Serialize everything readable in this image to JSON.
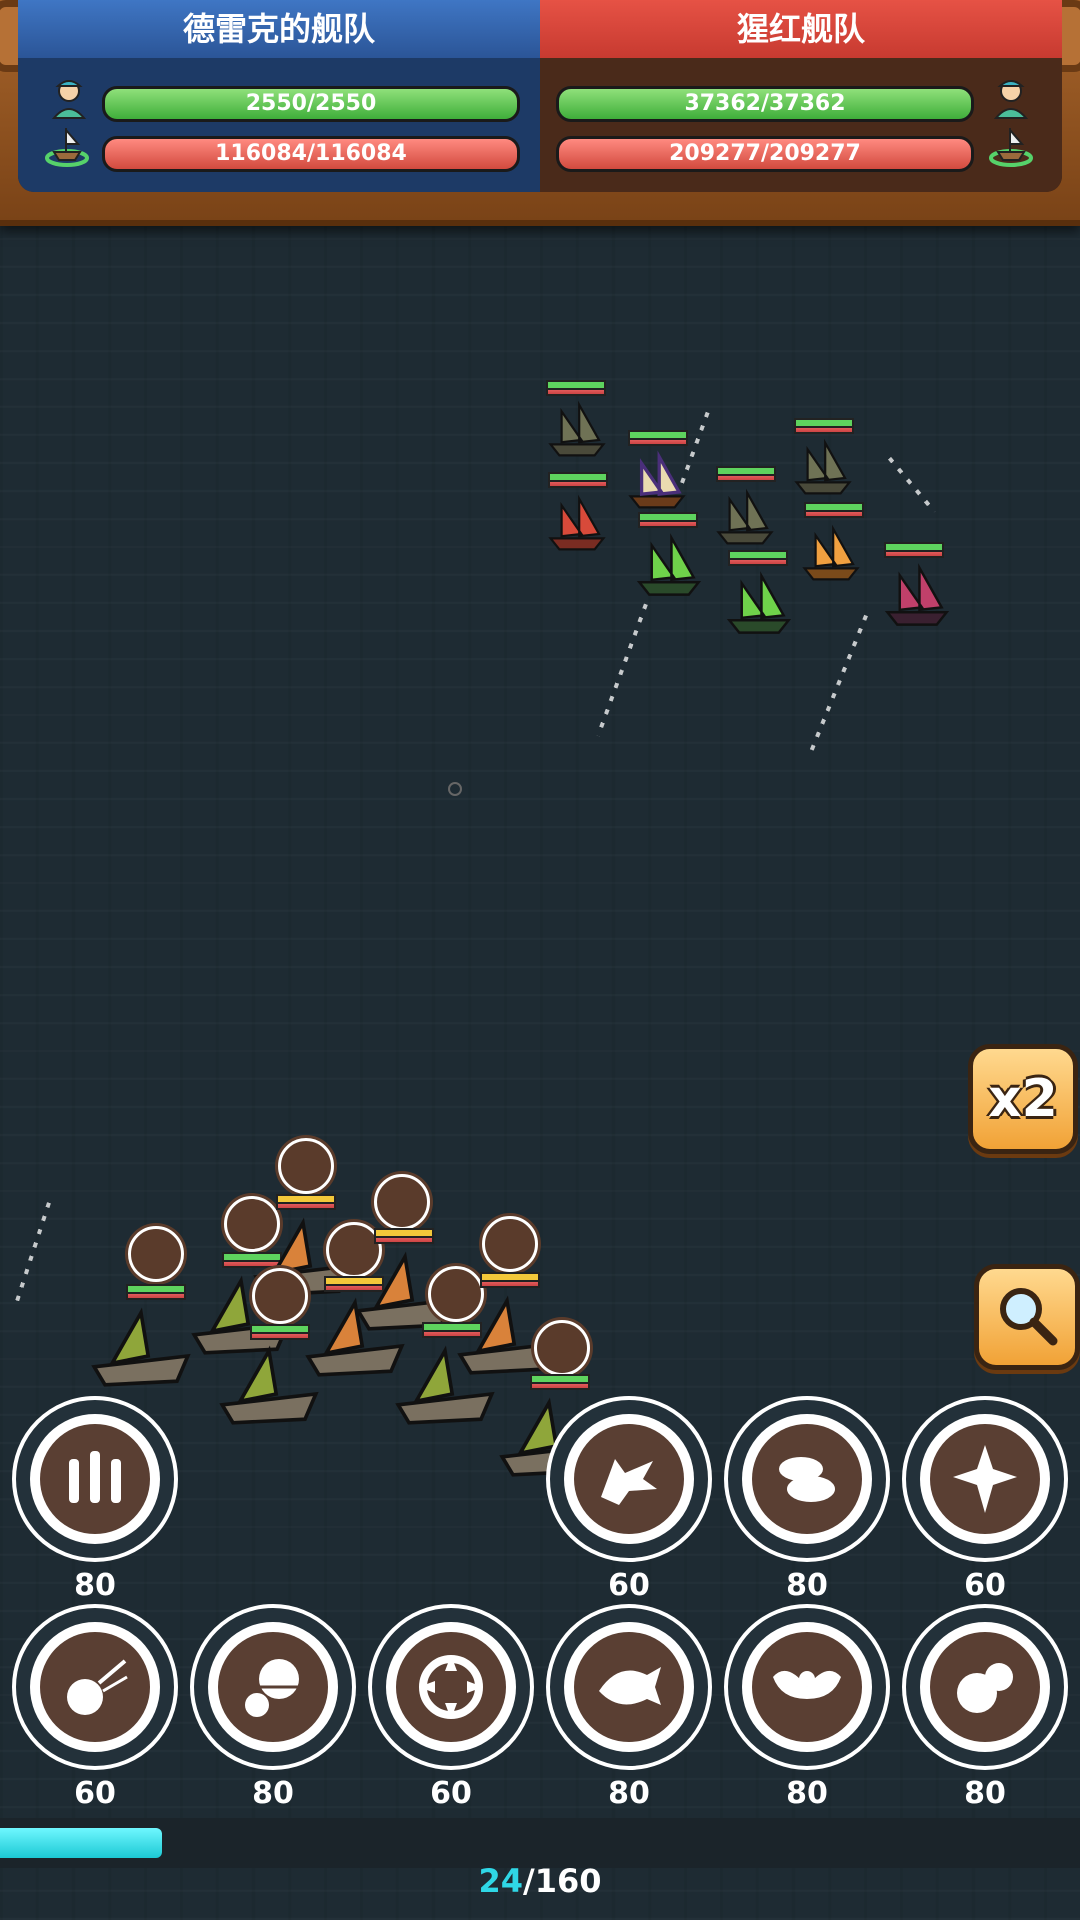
{
  "hud": {
    "left_team": {
      "name": "德雷克的舰队",
      "crew_hp": "2550/2550",
      "ship_hp": "116084/116084"
    },
    "right_team": {
      "name": "猩红舰队",
      "crew_hp": "37362/37362",
      "ship_hp": "209277/209277"
    }
  },
  "controls": {
    "speed_label": "x2",
    "magnify_icon": "magnifier-icon"
  },
  "skills": [
    {
      "icon": "cannons-icon",
      "cost": "80"
    },
    {
      "icon": "wolf-icon",
      "cost": "60"
    },
    {
      "icon": "rolls-icon",
      "cost": "80"
    },
    {
      "icon": "burst-icon",
      "cost": "60"
    },
    {
      "icon": "cannonball-icon",
      "cost": "60"
    },
    {
      "icon": "armor-icon",
      "cost": "80"
    },
    {
      "icon": "target-icon",
      "cost": "60"
    },
    {
      "icon": "fish-icon",
      "cost": "80"
    },
    {
      "icon": "wings-icon",
      "cost": "80"
    },
    {
      "icon": "blob-icon",
      "cost": "80"
    }
  ],
  "energy": {
    "current": "24",
    "max": "/160",
    "fraction": 0.15
  },
  "colors": {
    "blue_team": "#3f76c4",
    "red_team": "#e65245",
    "energy": "#2fd7e6"
  }
}
